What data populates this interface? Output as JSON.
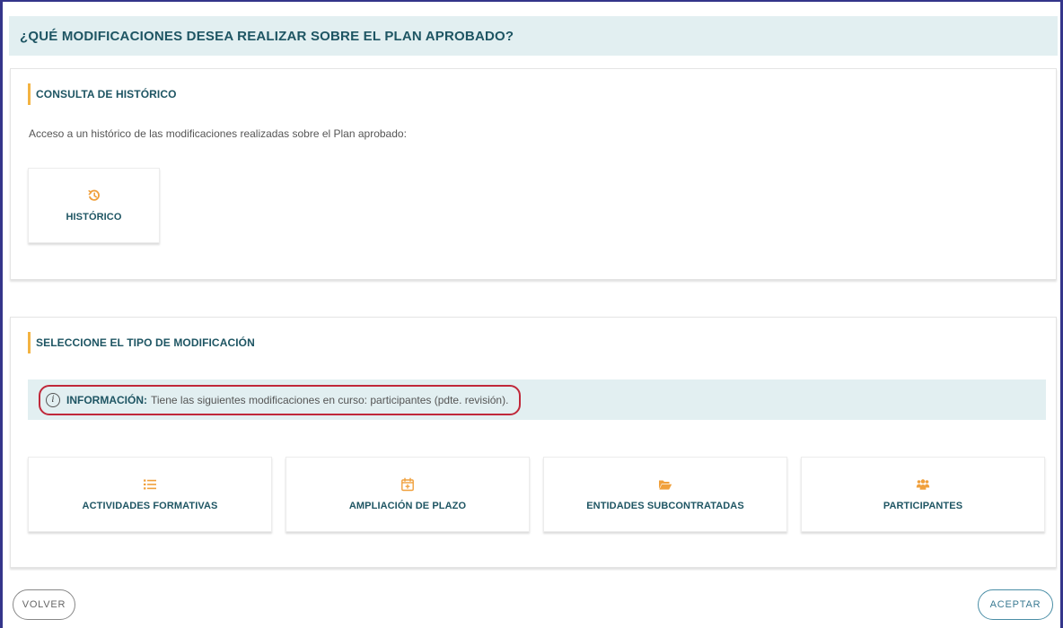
{
  "header": {
    "title": "¿QUÉ MODIFICACIONES DESEA REALIZAR SOBRE EL PLAN APROBADO?"
  },
  "historico_section": {
    "title": "CONSULTA DE HISTÓRICO",
    "description": "Acceso a un histórico de las modificaciones realizadas sobre el Plan aprobado:",
    "tile": {
      "label": "HISTÓRICO",
      "icon": "history-icon"
    }
  },
  "tipo_section": {
    "title": "SELECCIONE EL TIPO DE MODIFICACIÓN",
    "info": {
      "label": "INFORMACIÓN:",
      "text": "Tiene las siguientes modificaciones en curso: participantes (pdte. revisión).",
      "icon_glyph": "i"
    },
    "tiles": [
      {
        "label": "ACTIVIDADES FORMATIVAS",
        "icon": "list-icon"
      },
      {
        "label": "AMPLIACIÓN DE PLAZO",
        "icon": "calendar-plus-icon"
      },
      {
        "label": "ENTIDADES SUBCONTRATADAS",
        "icon": "folder-open-icon"
      },
      {
        "label": "PARTICIPANTES",
        "icon": "users-icon"
      }
    ]
  },
  "footer": {
    "back_label": "VOLVER",
    "accept_label": "ACEPTAR"
  },
  "colors": {
    "accent": "#f3b342",
    "title": "#1e5563",
    "header_bg": "#e2eff1",
    "highlight": "#c0283a"
  }
}
